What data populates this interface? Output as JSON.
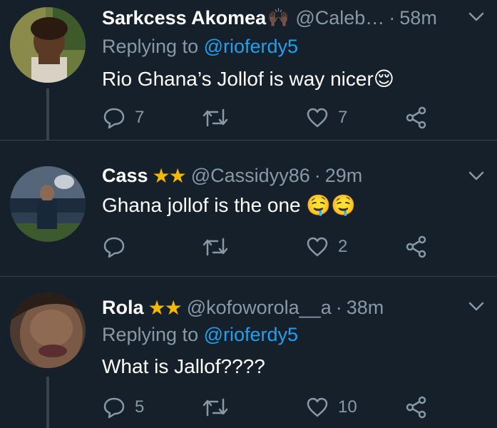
{
  "tweets": [
    {
      "name": "Sarkcess Akomea",
      "name_emoji": "🙌🏿",
      "stars": "",
      "handle": "@Caleb…",
      "time": "58m",
      "reply_prefix": "Replying to",
      "reply_mention": "@rioferdy5",
      "text": "Rio Ghana’s Jollof is way nicer😌",
      "replies": "7",
      "retweets": "",
      "likes": "7"
    },
    {
      "name": "Cass",
      "name_emoji": "",
      "stars": "★★",
      "handle": "@Cassidyy86",
      "time": "29m",
      "reply_prefix": "",
      "reply_mention": "",
      "text": "Ghana jollof is the one 🤤🤤",
      "replies": "",
      "retweets": "",
      "likes": "2"
    },
    {
      "name": "Rola",
      "name_emoji": "",
      "stars": "★★",
      "handle": "@kofoworola__a",
      "time": "38m",
      "reply_prefix": "Replying to",
      "reply_mention": "@rioferdy5",
      "text": "What is Jallof????",
      "replies": "5",
      "retweets": "",
      "likes": "10"
    }
  ],
  "icons": {
    "reply": "reply-icon",
    "retweet": "retweet-icon",
    "like": "heart-icon",
    "share": "share-icon",
    "menu": "chevron-down-icon"
  },
  "colors": {
    "background": "#15202b",
    "muted": "#8899a6",
    "link": "#1da1f2",
    "divider": "#38444d",
    "star": "#f5b800"
  }
}
